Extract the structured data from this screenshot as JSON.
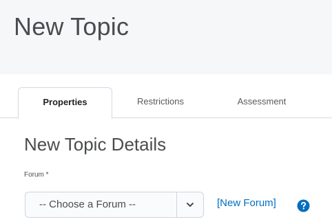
{
  "page": {
    "title": "New Topic"
  },
  "tabs": [
    {
      "label": "Properties",
      "active": true
    },
    {
      "label": "Restrictions",
      "active": false
    },
    {
      "label": "Assessment",
      "active": false
    }
  ],
  "section": {
    "title": "New Topic Details"
  },
  "forum_field": {
    "label": "Forum *",
    "selected_value": "-- Choose a Forum --",
    "arrow_icon": "chevron-down-icon"
  },
  "new_forum_link": {
    "label": "[New Forum]"
  },
  "help": {
    "icon": "question-circle-icon"
  },
  "colors": {
    "link": "#006fbf",
    "help_icon": "#006fbf",
    "text": "#494c4e",
    "header_background": "#f6f7f8",
    "tab_border": "#d3d9e3"
  }
}
